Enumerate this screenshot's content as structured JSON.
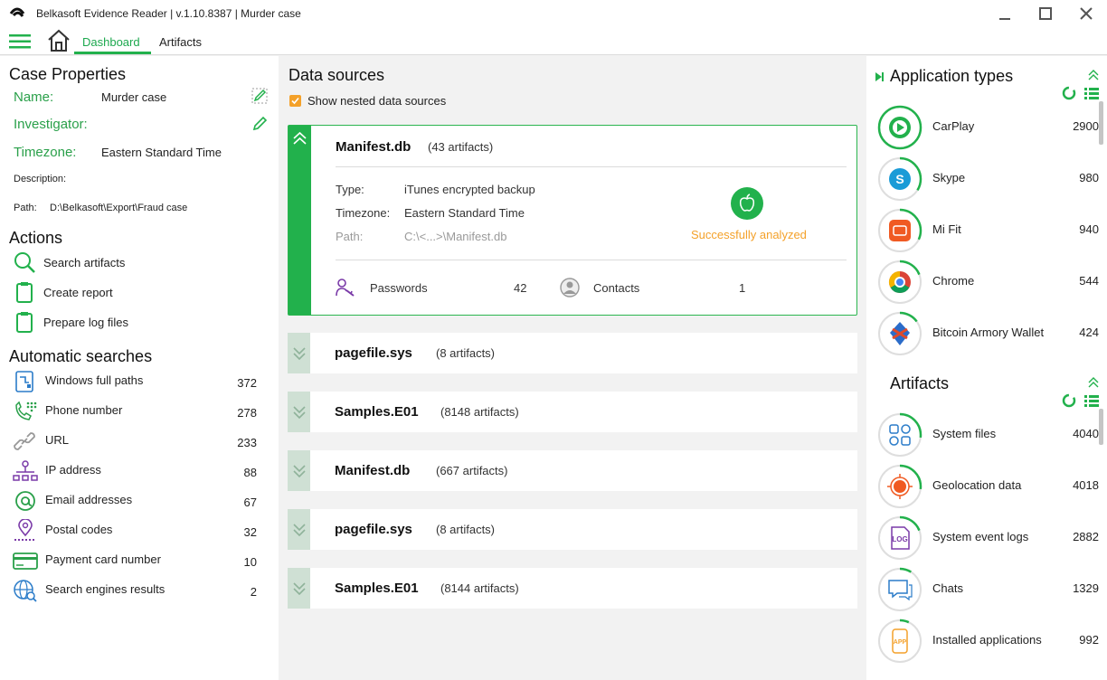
{
  "window": {
    "title": "Belkasoft Evidence Reader | v.1.10.8387 | Murder case"
  },
  "nav": {
    "tabs": [
      {
        "label": "Dashboard",
        "active": true
      },
      {
        "label": "Artifacts",
        "active": false
      }
    ]
  },
  "case_properties": {
    "heading": "Case Properties",
    "name_label": "Name:",
    "name_value": "Murder case",
    "investigator_label": "Investigator:",
    "investigator_value": "",
    "timezone_label": "Timezone:",
    "timezone_value": "Eastern Standard Time",
    "description_label": "Description:",
    "path_label": "Path:",
    "path_value": "D:\\Belkasoft\\Export\\Fraud case"
  },
  "actions": {
    "heading": "Actions",
    "items": [
      {
        "label": "Search artifacts",
        "icon": "search-icon"
      },
      {
        "label": "Create report",
        "icon": "clipboard-icon"
      },
      {
        "label": "Prepare log files",
        "icon": "clipboard-icon"
      }
    ]
  },
  "automatic_searches": {
    "heading": "Automatic searches",
    "items": [
      {
        "label": "Windows full paths",
        "count": "372",
        "icon": "windows-path-icon"
      },
      {
        "label": "Phone number",
        "count": "278",
        "icon": "phone-icon"
      },
      {
        "label": "URL",
        "count": "233",
        "icon": "link-icon"
      },
      {
        "label": "IP address",
        "count": "88",
        "icon": "network-icon"
      },
      {
        "label": "Email addresses",
        "count": "67",
        "icon": "at-icon"
      },
      {
        "label": "Postal codes",
        "count": "32",
        "icon": "location-pin-icon"
      },
      {
        "label": "Payment card number",
        "count": "10",
        "icon": "credit-card-icon"
      },
      {
        "label": "Search engines results",
        "count": "2",
        "icon": "globe-search-icon"
      }
    ]
  },
  "data_sources": {
    "heading": "Data sources",
    "nested_label": "Show nested data sources",
    "nested_checked": true,
    "expanded": {
      "name": "Manifest.db",
      "count": "(43 artifacts)",
      "type_label": "Type:",
      "type_value": "iTunes encrypted backup",
      "timezone_label": "Timezone:",
      "timezone_value": "Eastern Standard Time",
      "path_label": "Path:",
      "path_value": "C:\\<...>\\Manifest.db",
      "status": "Successfully analyzed",
      "stats": [
        {
          "label": "Passwords",
          "count": "42",
          "icon": "password-icon"
        },
        {
          "label": "Contacts",
          "count": "1",
          "icon": "contact-icon"
        }
      ]
    },
    "collapsed": [
      {
        "name": "pagefile.sys",
        "count": "(8 artifacts)"
      },
      {
        "name": "Samples.E01",
        "count": "(8148 artifacts)"
      },
      {
        "name": "Manifest.db",
        "count": "(667 artifacts)"
      },
      {
        "name": "pagefile.sys",
        "count": "(8 artifacts)"
      },
      {
        "name": "Samples.E01",
        "count": "(8144 artifacts)"
      }
    ]
  },
  "application_types": {
    "heading": "Application types",
    "items": [
      {
        "label": "CarPlay",
        "count": "2900",
        "icon": "carplay-icon",
        "share": 1.0
      },
      {
        "label": "Skype",
        "count": "980",
        "icon": "skype-icon",
        "share": 0.34
      },
      {
        "label": "Mi Fit",
        "count": "940",
        "icon": "mi-fit-icon",
        "share": 0.32
      },
      {
        "label": "Chrome",
        "count": "544",
        "icon": "chrome-icon",
        "share": 0.19
      },
      {
        "label": "Bitcoin Armory Wallet",
        "count": "424",
        "icon": "bitcoin-armory-icon",
        "share": 0.15
      }
    ]
  },
  "artifacts": {
    "heading": "Artifacts",
    "items": [
      {
        "label": "System files",
        "count": "4040",
        "icon": "system-files-icon",
        "share": 0.27
      },
      {
        "label": "Geolocation data",
        "count": "4018",
        "icon": "geolocation-icon",
        "share": 0.27
      },
      {
        "label": "System event logs",
        "count": "2882",
        "icon": "log-icon",
        "share": 0.19
      },
      {
        "label": "Chats",
        "count": "1329",
        "icon": "chat-icon",
        "share": 0.09
      },
      {
        "label": "Installed applications",
        "count": "992",
        "icon": "app-icon",
        "share": 0.07
      }
    ]
  },
  "colors": {
    "accent": "#22b14c",
    "warning": "#f4a12a"
  }
}
